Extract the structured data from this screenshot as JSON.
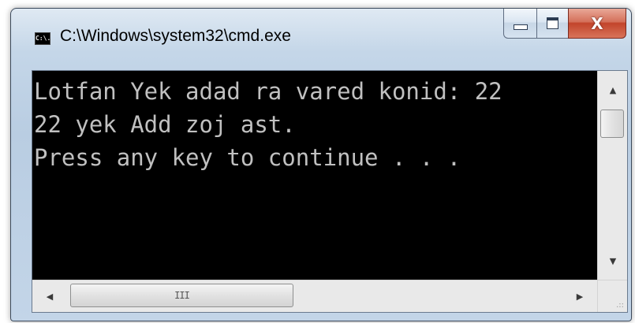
{
  "window": {
    "title": "C:\\Windows\\system32\\cmd.exe",
    "icon_text": "C:\\."
  },
  "captions": {
    "minimize_icon": "minimize-icon",
    "maximize_icon": "maximize-icon",
    "close_glyph": "X"
  },
  "console": {
    "lines": [
      "Lotfan Yek adad ra vared konid: 22",
      "22 yek Add zoj ast.",
      "Press any key to continue . . ."
    ]
  },
  "scrollbars": {
    "up_arrow": "▲",
    "down_arrow": "▼",
    "left_arrow": "◀",
    "right_arrow": "▶",
    "h_thumb_grip": "III",
    "size_grip": ".::"
  },
  "colors": {
    "console_bg": "#000000",
    "console_fg": "#c0c0c0",
    "close_button": "#c2442b"
  }
}
